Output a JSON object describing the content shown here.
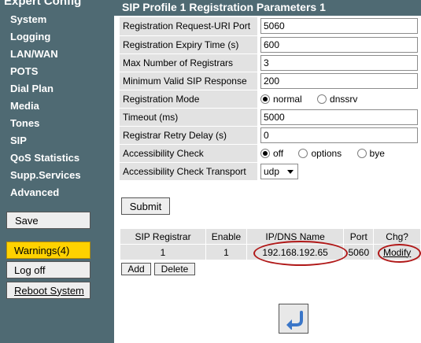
{
  "sidebar": {
    "title": "Expert Config",
    "items": [
      {
        "label": "System"
      },
      {
        "label": "Logging"
      },
      {
        "label": "LAN/WAN"
      },
      {
        "label": "POTS"
      },
      {
        "label": "Dial Plan"
      },
      {
        "label": "Media"
      },
      {
        "label": "Tones"
      },
      {
        "label": "SIP"
      },
      {
        "label": "QoS Statistics"
      },
      {
        "label": "Supp.Services"
      },
      {
        "label": "Advanced"
      }
    ],
    "save_label": "Save",
    "warnings_label": "Warnings(4)",
    "logoff_label": "Log off",
    "reboot_label": "Reboot System"
  },
  "header": {
    "title": "SIP Profile 1 Registration Parameters 1"
  },
  "form": {
    "request_uri_port": {
      "label": "Registration Request-URI Port",
      "value": "5060"
    },
    "expiry_time": {
      "label": "Registration Expiry Time (s)",
      "value": "600"
    },
    "max_registrars": {
      "label": "Max Number of Registrars",
      "value": "3"
    },
    "min_valid_response": {
      "label": "Minimum Valid SIP Response",
      "value": "200"
    },
    "registration_mode": {
      "label": "Registration Mode",
      "options": [
        "normal",
        "dnssrv"
      ],
      "selected": "normal"
    },
    "timeout": {
      "label": "Timeout (ms)",
      "value": "5000"
    },
    "retry_delay": {
      "label": "Registrar Retry Delay (s)",
      "value": "0"
    },
    "accessibility_check": {
      "label": "Accessibility Check",
      "options": [
        "off",
        "options",
        "bye"
      ],
      "selected": "off"
    },
    "check_transport": {
      "label": "Accessibility Check Transport",
      "value": "udp"
    },
    "submit_label": "Submit"
  },
  "registrars": {
    "headers": [
      "SIP Registrar",
      "Enable",
      "IP/DNS Name",
      "Port",
      "Chg?"
    ],
    "rows": [
      {
        "registrar": "1",
        "enable": "1",
        "ip": "192.168.192.65",
        "port": "5060",
        "action": "Modify"
      }
    ],
    "add_label": "Add",
    "delete_label": "Delete"
  },
  "colors": {
    "sidebar_bg": "#4f6a73",
    "warning_bg": "#ffd200",
    "label_bg": "#e2e2e2",
    "annotation": "#b01818",
    "back_arrow": "#3a76c8"
  },
  "icons": {
    "back": "back-arrow-icon"
  }
}
